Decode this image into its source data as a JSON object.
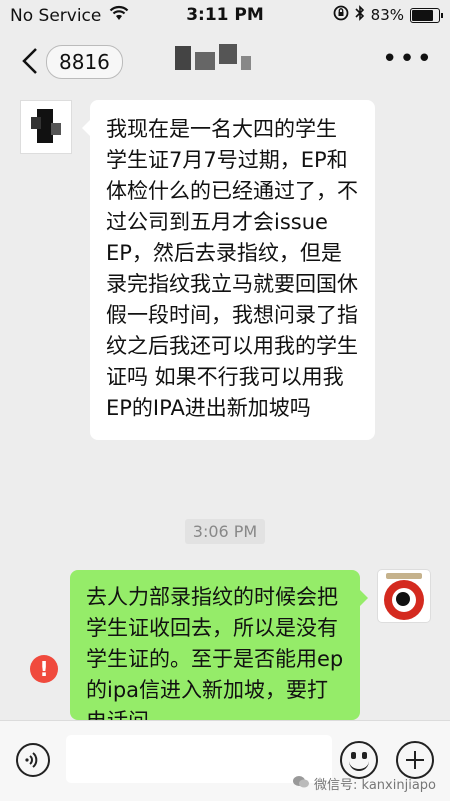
{
  "status_bar": {
    "carrier": "No Service",
    "time": "3:11 PM",
    "battery": "83%"
  },
  "nav": {
    "unread_badge": "8816"
  },
  "messages": [
    {
      "direction": "incoming",
      "text": "我现在是一名大四的学生 学生证7月7号过期，EP和体检什么的已经通过了，不过公司到五月才会issue EP，然后去录指纹，但是录完指纹我立马就要回国休假一段时间，我想问录了指纹之后我还可以用我的学生证吗 如果不行我可以用我EP的IPA进出新加坡吗"
    },
    {
      "direction": "outgoing",
      "status": "failed",
      "text": "去人力部录指纹的时候会把学生证收回去，所以是没有学生证的。至于是否能用ep的ipa信进入新加坡，要打电话问"
    }
  ],
  "timestamp": "3:06 PM",
  "error_symbol": "!",
  "watermark": "微信号: kanxinjiapo"
}
